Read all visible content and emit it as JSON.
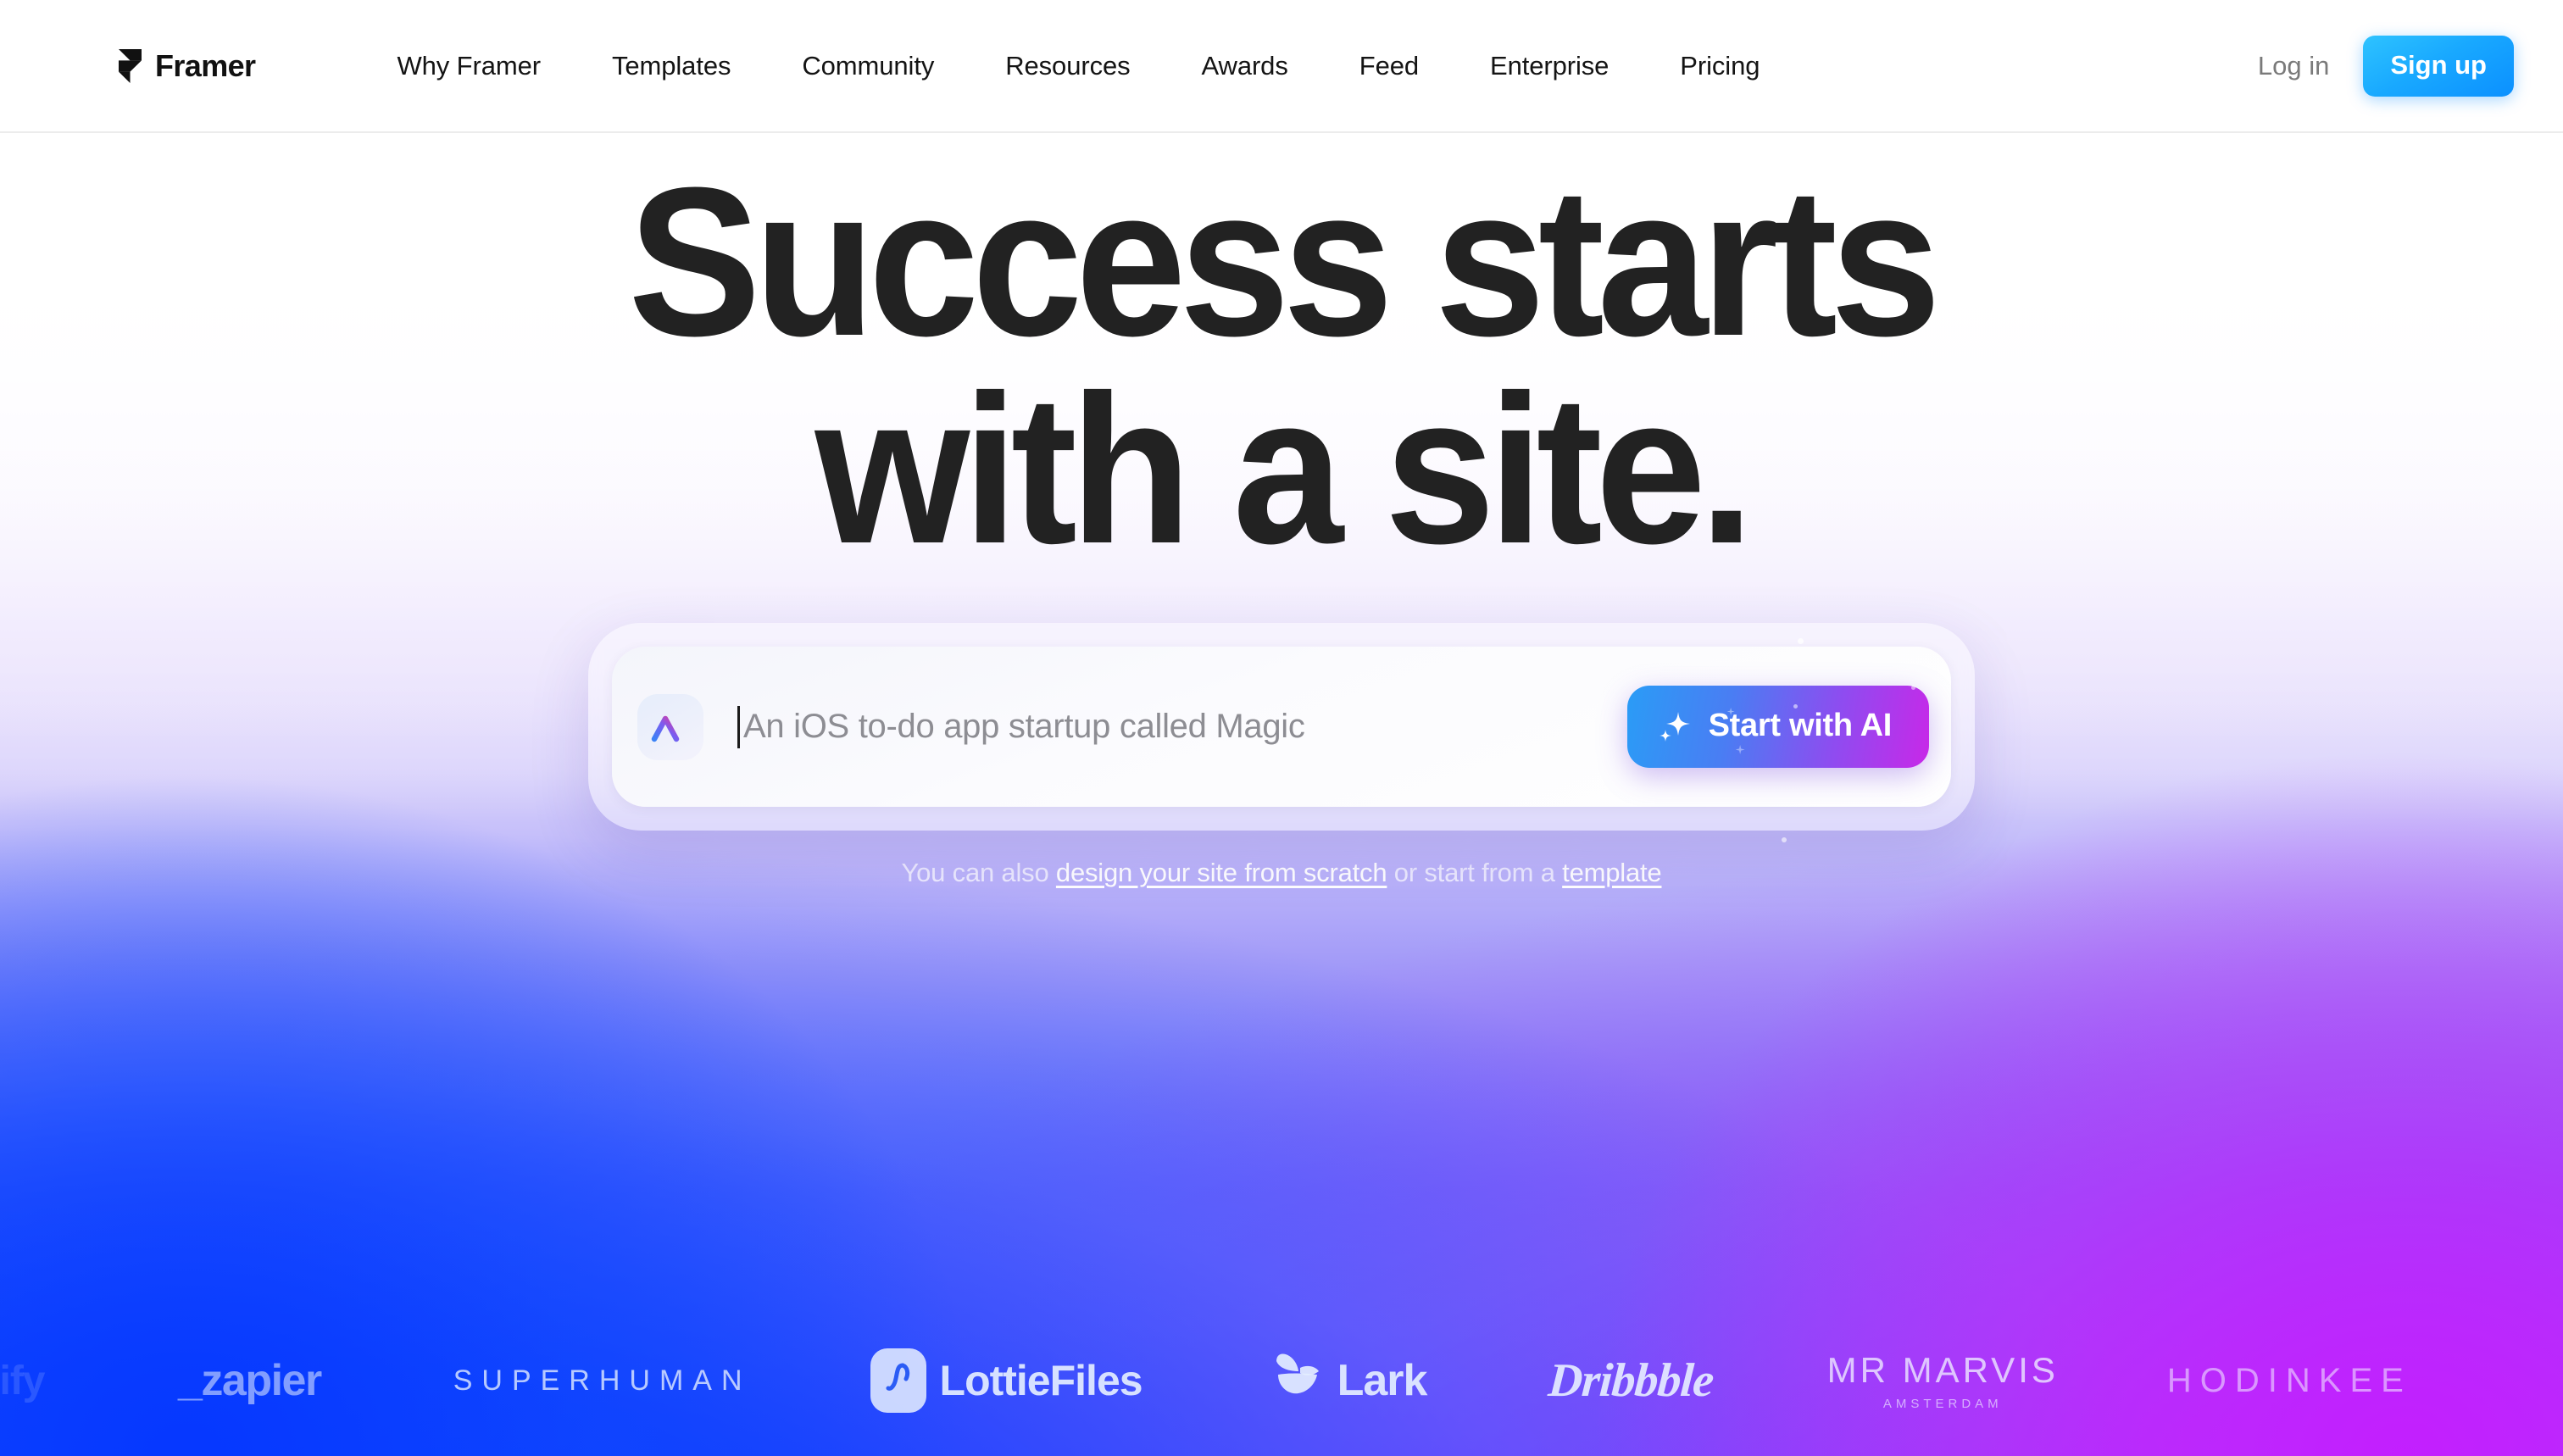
{
  "nav": {
    "brand": {
      "name": "Framer",
      "icon": "framer-logo-icon"
    },
    "links": [
      {
        "label": "Why Framer"
      },
      {
        "label": "Templates"
      },
      {
        "label": "Community"
      },
      {
        "label": "Resources"
      },
      {
        "label": "Awards"
      },
      {
        "label": "Feed"
      },
      {
        "label": "Enterprise"
      },
      {
        "label": "Pricing"
      }
    ],
    "login_label": "Log in",
    "signup_label": "Sign up",
    "signup_color": "#19a9ff"
  },
  "hero": {
    "headline_line1": "Success starts",
    "headline_line2": "with a site.",
    "headline_color": "#222222",
    "prompt": {
      "badge_icon": "ai-triangle-icon",
      "placeholder": "An iOS to-do app startup called Magic",
      "value": "",
      "button_label": "Start with AI",
      "button_icon": "sparkle-icon",
      "button_gradient_from": "#2a9cf6",
      "button_gradient_to": "#c828e8"
    },
    "subline": {
      "prefix": "You can also ",
      "link1": "design your site from scratch",
      "middle": " or start from a ",
      "link2": "template"
    }
  },
  "logos": {
    "items": [
      {
        "name": "ify",
        "text": "ify"
      },
      {
        "name": "zapier",
        "text": "_zapier"
      },
      {
        "name": "superhuman",
        "text": "SUPERHUMAN"
      },
      {
        "name": "lottiefiles",
        "text": "LottieFiles"
      },
      {
        "name": "lark",
        "text": "Lark"
      },
      {
        "name": "dribbble",
        "text": "Dribbble"
      },
      {
        "name": "mr-marvis",
        "text": "MR MARVIS",
        "sub": "AMSTERDAM"
      },
      {
        "name": "hodinkee",
        "text": "HODINKEE"
      }
    ]
  },
  "theme": {
    "bg_blue": "#0a3cff",
    "bg_magenta": "#c02bff",
    "bg_white": "#ffffff"
  }
}
